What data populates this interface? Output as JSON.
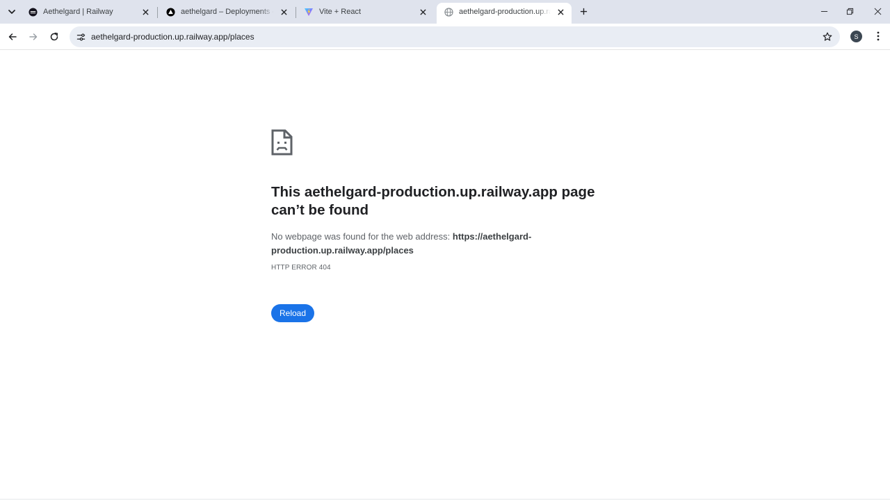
{
  "browser": {
    "tabs": [
      {
        "title": "Aethelgard | Railway",
        "favicon": "railway-icon",
        "active": false
      },
      {
        "title": "aethelgard – Deployments – Vercel",
        "favicon": "vercel-icon",
        "active": false
      },
      {
        "title": "Vite + React",
        "favicon": "vite-icon",
        "active": false
      },
      {
        "title": "aethelgard-production.up.railway.app/places",
        "favicon": "globe-icon",
        "active": true
      }
    ],
    "address_bar": {
      "url": "aethelgard-production.up.railway.app/places"
    },
    "profile_initial": "S"
  },
  "error_page": {
    "headline": "This aethelgard-production.up.railway.app page can’t be found",
    "description_prefix": "No webpage was found for the web address: ",
    "description_url": "https://aethelgard-production.up.railway.app/places",
    "error_code": "HTTP ERROR 404",
    "reload_label": "Reload"
  },
  "colors": {
    "tabstrip_bg": "#dfe3ed",
    "omnibox_bg": "#e9edf4",
    "accent": "#1a73e8",
    "text": "#202124",
    "secondary_text": "#5f6368"
  }
}
